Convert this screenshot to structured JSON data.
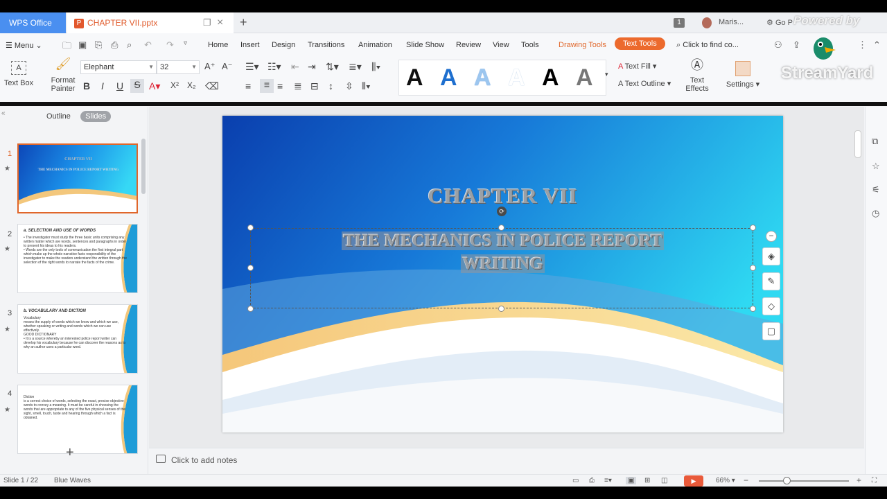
{
  "tabs": {
    "app_label": "WPS Office",
    "doc_label": "CHAPTER VII.pptx",
    "user_label": "Maris...",
    "go_label": "Go P",
    "badge": "1"
  },
  "menu": {
    "menu_label": "Menu",
    "items": [
      "Home",
      "Insert",
      "Design",
      "Transitions",
      "Animation",
      "Slide Show",
      "Review",
      "View",
      "Tools",
      "Drawing Tools",
      "Text Tools"
    ],
    "search_placeholder": "Click to find co..."
  },
  "ribbon": {
    "text_box": "Text Box",
    "format_painter_1": "Format",
    "format_painter_2": "Painter",
    "font": "Elephant",
    "size": "32",
    "text_fill": "Text Fill",
    "text_outline": "Text Outline",
    "text_effects_1": "Text",
    "text_effects_2": "Effects",
    "settings": "Settings",
    "gallery_letter": "A"
  },
  "panel": {
    "tab_outline": "Outline",
    "tab_slides": "Slides",
    "slides": [
      {
        "num": "1",
        "title": "CHAPTER VII",
        "subtitle": "THE MECHANICS IN POLICE REPORT WRITING"
      },
      {
        "num": "2",
        "title": "a. SELECTION AND USE OF WORDS",
        "body": "• The investigator must study the three basic units comprising any written matter which are words, sentences and paragraphs in order to present his ideas to his readers.\n• Words are the only tools of communication the first integral part which make up the whole narrative facts responsibility of the investigator to make the readers understand the written through the selection of the right words to narrate the facts of the crime."
      },
      {
        "num": "3",
        "title": "b. VOCABULARY AND DICTION",
        "body": "Vocabulary\nmeans the supply of words which we know and which we use, whether speaking or writing and words which we can use effectively.\n   GOOD DICTIONARY\n• It is a source whereby an interested police report writer can develop his vocabulary because he can discover the reasons as to why an author uses a particular word."
      },
      {
        "num": "4",
        "title": "",
        "body": "Diction\nis a correct choice of words, selecting the exact, precise objective words to convey a meaning. It must be careful in choosing the words that are appropriate to any of the five physical senses of the sight, smell, touch, taste and hearing through which a fact is obtained."
      }
    ]
  },
  "slide": {
    "title": "CHAPTER VII",
    "subtitle_line1": "THE MECHANICS IN POLICE REPORT",
    "subtitle_line2": "WRITING"
  },
  "notes": {
    "placeholder": "Click to add notes"
  },
  "status": {
    "slide_info": "Slide 1 / 22",
    "theme": "Blue Waves",
    "zoom": "66%"
  },
  "overlay": {
    "powered_by": "Powered by",
    "brand": "StreamYard"
  },
  "colors": {
    "accent": "#ec6a2d",
    "wps_blue": "#4a8ff0"
  }
}
